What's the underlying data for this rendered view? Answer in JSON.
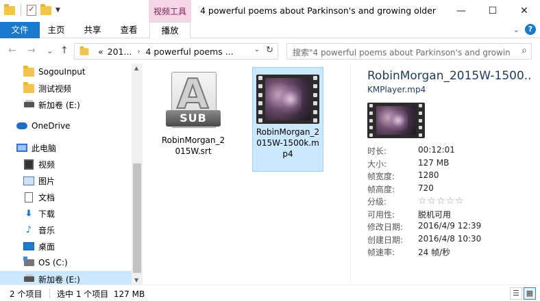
{
  "window": {
    "title": "4 powerful poems about Parkinson's and growing older",
    "context_tab": "视频工具",
    "controls": {
      "minimize": "—",
      "maximize": "☐",
      "close": "✕"
    }
  },
  "ribbon": {
    "tabs": [
      {
        "label": "文件"
      },
      {
        "label": "主页"
      },
      {
        "label": "共享"
      },
      {
        "label": "查看"
      },
      {
        "label": "播放"
      }
    ],
    "help": "?",
    "collapse": "⌄"
  },
  "nav": {
    "back": "←",
    "forward": "→",
    "recent": "⌄",
    "up": "↑"
  },
  "address": {
    "prefix": "«",
    "crumbs": [
      "201...",
      "4 powerful poems ..."
    ],
    "separator": "›",
    "dropdown": "⌄",
    "refresh": "↻"
  },
  "search": {
    "placeholder": "搜索\"4 powerful poems about Parkinson's and growin...",
    "icon": "search-icon"
  },
  "navpane": {
    "items": [
      {
        "label": "SogouInput",
        "icon": "folder-icon",
        "selected": false
      },
      {
        "label": "测试视频",
        "icon": "folder-icon",
        "selected": false
      },
      {
        "label": "新加卷 (E:)",
        "icon": "drive-icon",
        "selected": false
      },
      {
        "label": "OneDrive",
        "icon": "cloud-icon",
        "selected": false
      },
      {
        "label": "此电脑",
        "icon": "computer-icon",
        "selected": false
      },
      {
        "label": "视频",
        "icon": "video-icon",
        "selected": false
      },
      {
        "label": "图片",
        "icon": "pictures-icon",
        "selected": false
      },
      {
        "label": "文档",
        "icon": "document-icon",
        "selected": false
      },
      {
        "label": "下载",
        "icon": "download-icon",
        "selected": false
      },
      {
        "label": "音乐",
        "icon": "music-icon",
        "selected": false
      },
      {
        "label": "桌面",
        "icon": "desktop-icon",
        "selected": false
      },
      {
        "label": "OS (C:)",
        "icon": "os-drive-icon",
        "selected": false
      },
      {
        "label": "新加卷 (E:)",
        "icon": "drive-icon",
        "selected": true
      }
    ]
  },
  "files": [
    {
      "name": "RobinMorgan_2015W.srt",
      "display": "RobinMorgan_2\n015W.srt",
      "icon": "subtitle-file-icon",
      "badge": "SUB",
      "letter": "A",
      "selected": false
    },
    {
      "name": "RobinMorgan_2015W-1500k.mp4",
      "display": "RobinMorgan_2\n015W-1500k.m\np4",
      "icon": "video-file-icon",
      "selected": true
    }
  ],
  "details": {
    "title": "RobinMorgan_2015W-1500...",
    "subtitle": "KMPlayer.mp4",
    "properties": [
      {
        "key": "时长:",
        "value": "00:12:01"
      },
      {
        "key": "大小:",
        "value": "127 MB"
      },
      {
        "key": "帧宽度:",
        "value": "1280"
      },
      {
        "key": "帧高度:",
        "value": "720"
      },
      {
        "key": "分级:",
        "value": "",
        "stars": 5
      },
      {
        "key": "可用性:",
        "value": "脱机可用"
      },
      {
        "key": "修改日期:",
        "value": "2016/4/9 12:39"
      },
      {
        "key": "创建日期:",
        "value": "2016/4/8 10:30"
      },
      {
        "key": "帧速率:",
        "value": "24 帧/秒"
      }
    ]
  },
  "status": {
    "count": "2 个项目",
    "selection": "选中 1 个项目  127 MB"
  },
  "colors": {
    "accent": "#1979ca",
    "selection": "#cce8ff",
    "context_tab": "#f4d6e6"
  }
}
